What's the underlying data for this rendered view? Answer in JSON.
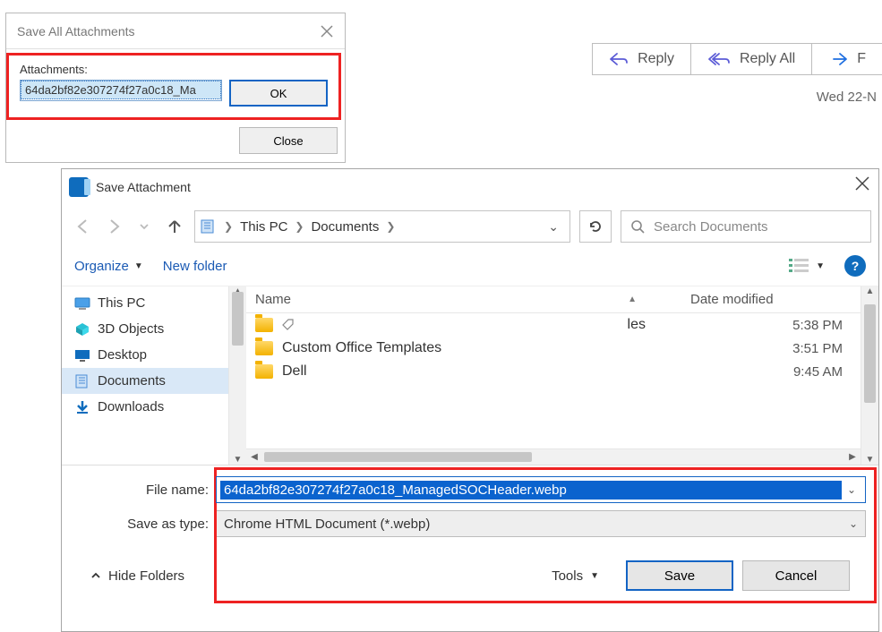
{
  "save_all": {
    "title": "Save All Attachments",
    "label": "Attachments:",
    "item": "64da2bf82e307274f27a0c18_Ma",
    "ok": "OK",
    "close": "Close"
  },
  "mail": {
    "reply": "Reply",
    "reply_all": "Reply All",
    "forward_initial": "F",
    "date": "Wed 22-N"
  },
  "fd": {
    "title": "Save Attachment",
    "crumbs": {
      "pc": "This PC",
      "docs": "Documents"
    },
    "search_placeholder": "Search Documents",
    "toolbar": {
      "organize": "Organize",
      "new_folder": "New folder"
    },
    "columns": {
      "name": "Name",
      "date": "Date modified"
    },
    "tree": {
      "this_pc": "This PC",
      "objects3d": "3D Objects",
      "desktop": "Desktop",
      "documents": "Documents",
      "downloads": "Downloads"
    },
    "rows": [
      {
        "name_suffix": "les",
        "time": "5:38 PM"
      },
      {
        "name": "Custom Office Templates",
        "time": "3:51 PM"
      },
      {
        "name": "Dell",
        "time": "9:45 AM"
      }
    ],
    "labels": {
      "file_name": "File name:",
      "save_as_type": "Save as type:"
    },
    "file_name_value": "64da2bf82e307274f27a0c18_ManagedSOCHeader.webp",
    "save_as_type_value": "Chrome HTML Document (*.webp)",
    "footer": {
      "hide": "Hide Folders",
      "tools": "Tools",
      "save": "Save",
      "cancel": "Cancel"
    }
  }
}
